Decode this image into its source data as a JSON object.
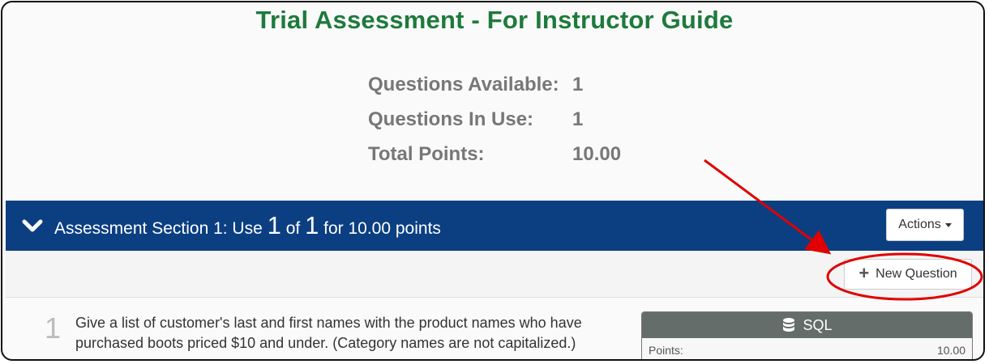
{
  "page": {
    "title": "Trial Assessment - For Instructor Guide"
  },
  "stats": [
    {
      "label": "Questions Available:",
      "value": "1"
    },
    {
      "label": "Questions In Use:",
      "value": "1"
    },
    {
      "label": "Total Points:",
      "value": "10.00"
    }
  ],
  "section": {
    "prefix": "Assessment Section 1: Use ",
    "use_count": "1",
    "of": " of ",
    "total": "1",
    "suffix": " for 10.00 points",
    "actions_label": "Actions"
  },
  "toolbar": {
    "new_question_label": "New Question"
  },
  "question": {
    "number": "1",
    "text": "Give a list of customer's last and first names with the product names who have purchased boots priced $10 and under. (Category names are not capitalized.)",
    "type_label": "SQL",
    "points_label": "Points:",
    "points_value": "10.00"
  },
  "colors": {
    "title_green": "#1e7a3c",
    "header_blue": "#0b3f82",
    "annotation_red": "#e00000",
    "card_header_gray": "#656d6a"
  },
  "icons": {
    "chevron": "chevron-down-icon",
    "caret": "caret-down-icon",
    "plus": "plus-icon",
    "database": "database-icon"
  }
}
